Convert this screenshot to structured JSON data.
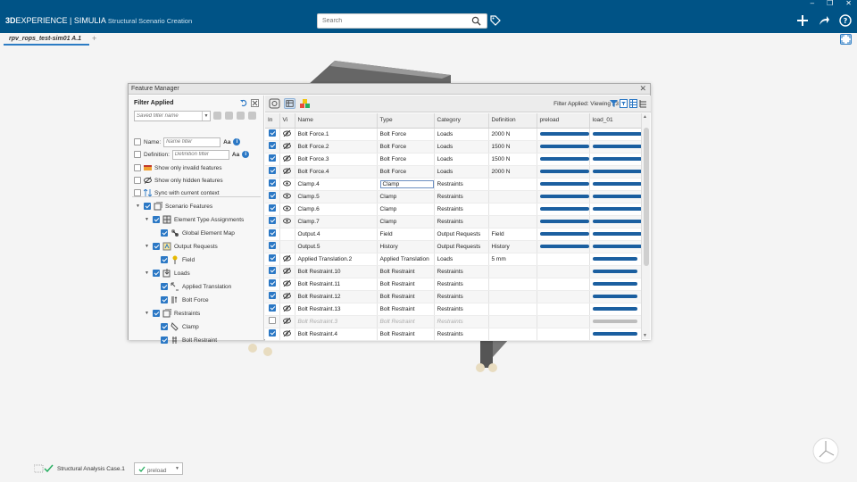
{
  "app": {
    "brand_bold": "3D",
    "brand_rest": "EXPERIENCE | SIMULIA",
    "app_name": "Structural Scenario Creation",
    "search_placeholder": "Search",
    "tab_name": "rpv_rops_test-sim01 A.1",
    "tab_add": "+",
    "accent": "#005386"
  },
  "window_controls": {
    "minimize": "–",
    "restore": "❐",
    "close": "✕"
  },
  "feature_manager": {
    "title": "Feature Manager",
    "close": "✕",
    "filter_applied_title": "Filter Applied",
    "saved_filter_placeholder": "Saved filter name",
    "name_label": "Name:",
    "name_placeholder": "Name filter",
    "definition_label": "Definition:",
    "definition_placeholder": "Definition filter",
    "aa": "Aa",
    "info": "i",
    "opt_invalid": "Show only invalid features",
    "opt_hidden": "Show only hidden features",
    "opt_sync": "Sync with current context",
    "filter_status": "Filter Applied: Viewing 23",
    "tree": {
      "scenario": "Scenario Features",
      "eta": "Element Type Assignments",
      "gem": "Global Element Map",
      "output": "Output Requests",
      "field": "Field",
      "loads": "Loads",
      "applied": "Applied Translation",
      "bolt_force": "Bolt Force",
      "restraints": "Restraints",
      "clamp": "Clamp",
      "bolt_restraint": "Bolt Restraint"
    },
    "columns": [
      "In",
      "Vi",
      "Name",
      "Type",
      "Category",
      "Definition",
      "preload",
      "load_01"
    ],
    "rows": [
      {
        "in": true,
        "vi": "hidden",
        "name": "Bolt Force.1",
        "type": "Bolt Force",
        "category": "Loads",
        "definition": "2000 N",
        "preload": "full",
        "load_01": "full"
      },
      {
        "in": true,
        "vi": "hidden",
        "name": "Bolt Force.2",
        "type": "Bolt Force",
        "category": "Loads",
        "definition": "1500 N",
        "preload": "full",
        "load_01": "full"
      },
      {
        "in": true,
        "vi": "hidden",
        "name": "Bolt Force.3",
        "type": "Bolt Force",
        "category": "Loads",
        "definition": "1500 N",
        "preload": "full",
        "load_01": "full"
      },
      {
        "in": true,
        "vi": "hidden",
        "name": "Bolt Force.4",
        "type": "Bolt Force",
        "category": "Loads",
        "definition": "2000 N",
        "preload": "full",
        "load_01": "full"
      },
      {
        "in": true,
        "vi": "visible",
        "name": "Clamp.4",
        "type": "Clamp",
        "category": "Restraints",
        "definition": "",
        "preload": "full",
        "load_01": "full",
        "editing": true
      },
      {
        "in": true,
        "vi": "visible",
        "name": "Clamp.5",
        "type": "Clamp",
        "category": "Restraints",
        "definition": "",
        "preload": "full",
        "load_01": "full"
      },
      {
        "in": true,
        "vi": "visible",
        "name": "Clamp.6",
        "type": "Clamp",
        "category": "Restraints",
        "definition": "",
        "preload": "full",
        "load_01": "full"
      },
      {
        "in": true,
        "vi": "visible",
        "name": "Clamp.7",
        "type": "Clamp",
        "category": "Restraints",
        "definition": "",
        "preload": "full",
        "load_01": "full"
      },
      {
        "in": true,
        "vi": "",
        "name": "Output.4",
        "type": "Field",
        "category": "Output Requests",
        "definition": "Field",
        "preload": "full",
        "load_01": "full"
      },
      {
        "in": true,
        "vi": "",
        "name": "Output.5",
        "type": "History",
        "category": "Output Requests",
        "definition": "History",
        "preload": "full",
        "load_01": "full"
      },
      {
        "in": true,
        "vi": "hidden",
        "name": "Applied Translation.2",
        "type": "Applied Translation",
        "category": "Loads",
        "definition": "5 mm",
        "preload": "none",
        "load_01": "full"
      },
      {
        "in": true,
        "vi": "hidden",
        "name": "Bolt Restraint.10",
        "type": "Bolt Restraint",
        "category": "Restraints",
        "definition": "",
        "preload": "none",
        "load_01": "full"
      },
      {
        "in": true,
        "vi": "hidden",
        "name": "Bolt Restraint.11",
        "type": "Bolt Restraint",
        "category": "Restraints",
        "definition": "",
        "preload": "none",
        "load_01": "full"
      },
      {
        "in": true,
        "vi": "hidden",
        "name": "Bolt Restraint.12",
        "type": "Bolt Restraint",
        "category": "Restraints",
        "definition": "",
        "preload": "none",
        "load_01": "full"
      },
      {
        "in": true,
        "vi": "hidden",
        "name": "Bolt Restraint.13",
        "type": "Bolt Restraint",
        "category": "Restraints",
        "definition": "",
        "preload": "none",
        "load_01": "full"
      },
      {
        "in": false,
        "vi": "hidden",
        "name": "Bolt Restraint.3",
        "type": "Bolt Restraint",
        "category": "Restraints",
        "definition": "",
        "preload": "none",
        "load_01": "grey",
        "dim": true
      },
      {
        "in": true,
        "vi": "hidden",
        "name": "Bolt Restraint.4",
        "type": "Bolt Restraint",
        "category": "Restraints",
        "definition": "",
        "preload": "none",
        "load_01": "full"
      }
    ]
  },
  "bottom_bar": {
    "case_name": "Structural Analysis Case.1",
    "step_value": "preload"
  }
}
